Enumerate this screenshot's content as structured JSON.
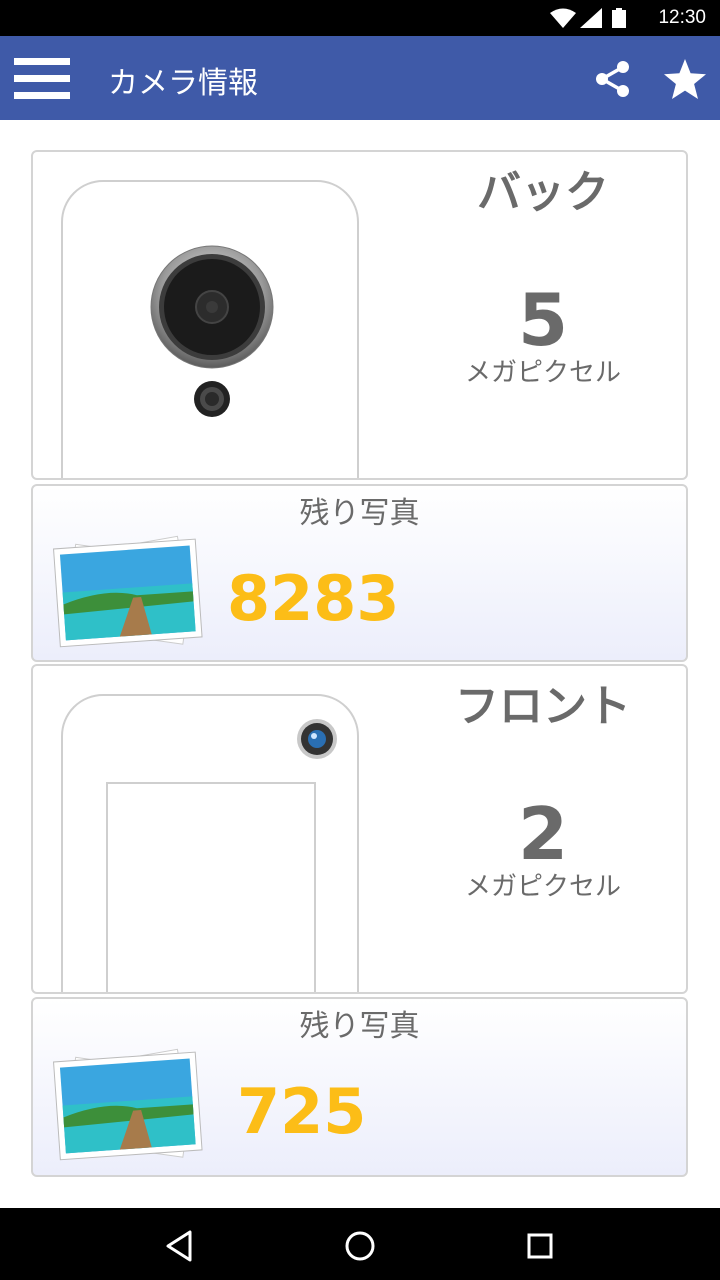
{
  "status": {
    "time": "12:30"
  },
  "app_bar": {
    "title": "カメラ情報"
  },
  "back_camera": {
    "label": "バック",
    "megapixels": "5",
    "unit": "メガピクセル",
    "photos_title": "残り写真",
    "photos_left": "8283"
  },
  "front_camera": {
    "label": "フロント",
    "megapixels": "2",
    "unit": "メガピクセル",
    "photos_title": "残り写真",
    "photos_left": "725"
  },
  "colors": {
    "app_bar": "#3f5aa8",
    "accent_count": "#fcbd17",
    "label_gray": "#6a6a6a"
  },
  "icons": [
    "menu-icon",
    "share-icon",
    "star-icon",
    "wifi-icon",
    "signal-icon",
    "battery-icon",
    "back-nav-icon",
    "home-nav-icon",
    "recents-nav-icon"
  ]
}
